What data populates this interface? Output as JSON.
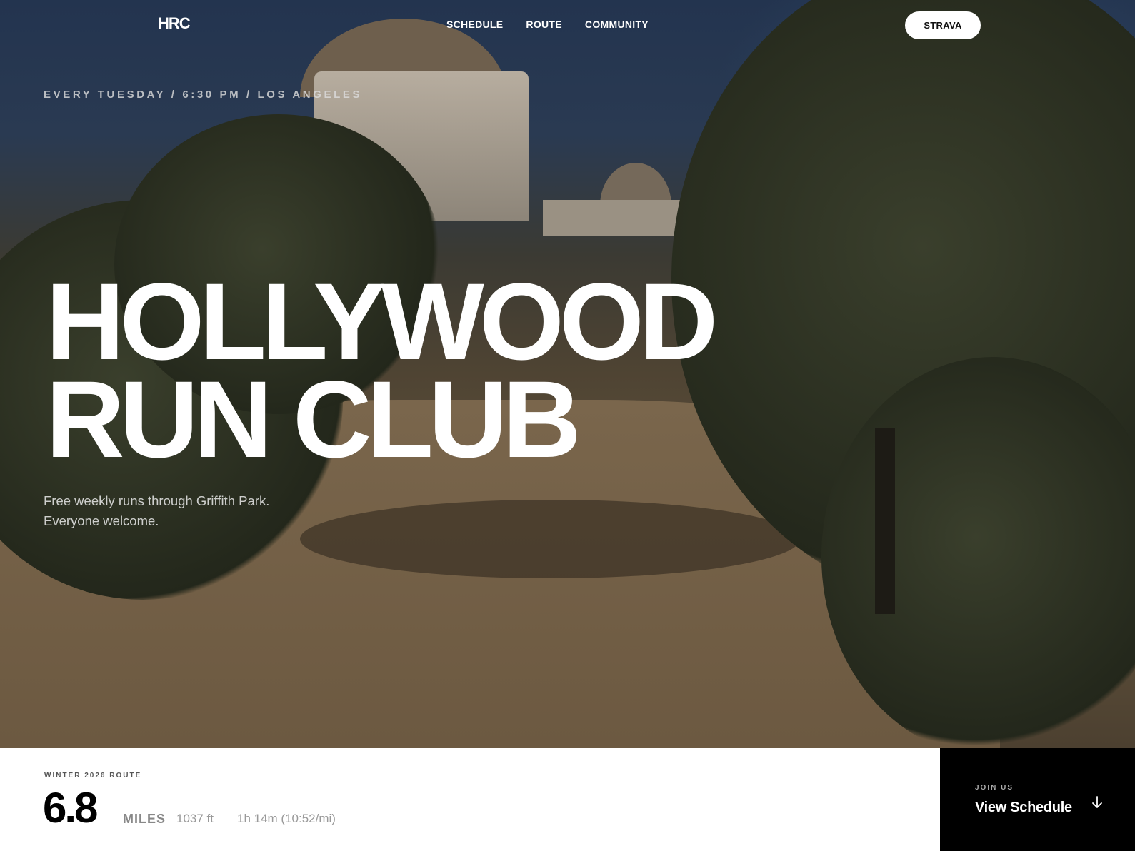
{
  "nav": {
    "logo": "HRC",
    "links": [
      "SCHEDULE",
      "ROUTE",
      "COMMUNITY"
    ],
    "cta": "STRAVA"
  },
  "hero": {
    "eyebrow": "EVERY TUESDAY / 6:30 PM / LOS ANGELES",
    "title_line1": "HOLLYWOOD",
    "title_line2": "RUN CLUB",
    "subtitle_line1": "Free weekly runs through Griffith Park.",
    "subtitle_line2": "Everyone welcome."
  },
  "route": {
    "label": "WINTER 2026 ROUTE",
    "distance": "6.8",
    "unit": "MILES",
    "elevation": "1037 ft",
    "time": "1h 14m (10:52/mi)"
  },
  "join": {
    "label": "JOIN US",
    "link": "View Schedule",
    "icon": "arrow-down-icon"
  },
  "colors": {
    "accent": "#ffffff",
    "panel_dark": "#000000",
    "panel_light": "#ffffff"
  }
}
